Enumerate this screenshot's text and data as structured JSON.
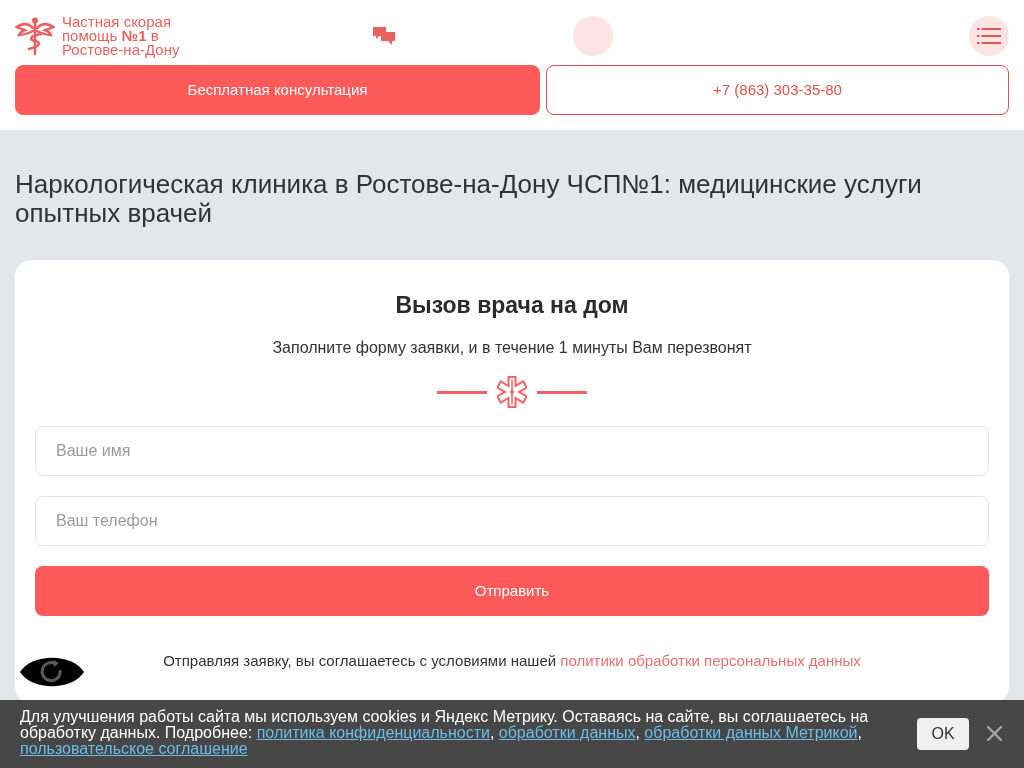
{
  "header": {
    "logo_text": "Частная скорая помощь **№1** в Ростове-на-Дону",
    "actions": [
      {
        "kind": "primary",
        "label": "Бесплатная консультация"
      },
      {
        "kind": "outline",
        "label": "+7 (863) 303-35-80"
      }
    ]
  },
  "page_title": "Наркологическая клиника в Ростове-на-Дону ЧСП№1: медицинские услуги опытных врачей",
  "callback_form": {
    "title": "Вызов врача на дом",
    "subtitle": "Заполните форму заявки, и в течение 1 минуты Вам перезвонят",
    "fields": [
      {
        "placeholder": "Ваше имя"
      },
      {
        "placeholder": "Ваш телефон"
      }
    ],
    "submit": "Отправить",
    "consent_text": "Отправляя заявку, вы соглашаетесь с условиями нашей",
    "consent_link": "политики обработки персональных данных"
  },
  "cookie_notice": {
    "segments": [
      {
        "kind": "text",
        "text": "Для улучшения работы сайта мы используем cookies и Яндекс Метрику. Оставаясь на сайте, вы соглашаетесь на обработку данных. Подробнее: "
      },
      {
        "kind": "link",
        "text": "политика конфиденциальности"
      },
      {
        "kind": "text",
        "text": ", "
      },
      {
        "kind": "link",
        "text": "обработки данных"
      },
      {
        "kind": "text",
        "text": ", "
      },
      {
        "kind": "link",
        "text": "обработки данных Метрикой"
      },
      {
        "kind": "text",
        "text": ", "
      },
      {
        "kind": "link",
        "text": "пользовательское соглашение"
      }
    ],
    "accept": "OK"
  }
}
